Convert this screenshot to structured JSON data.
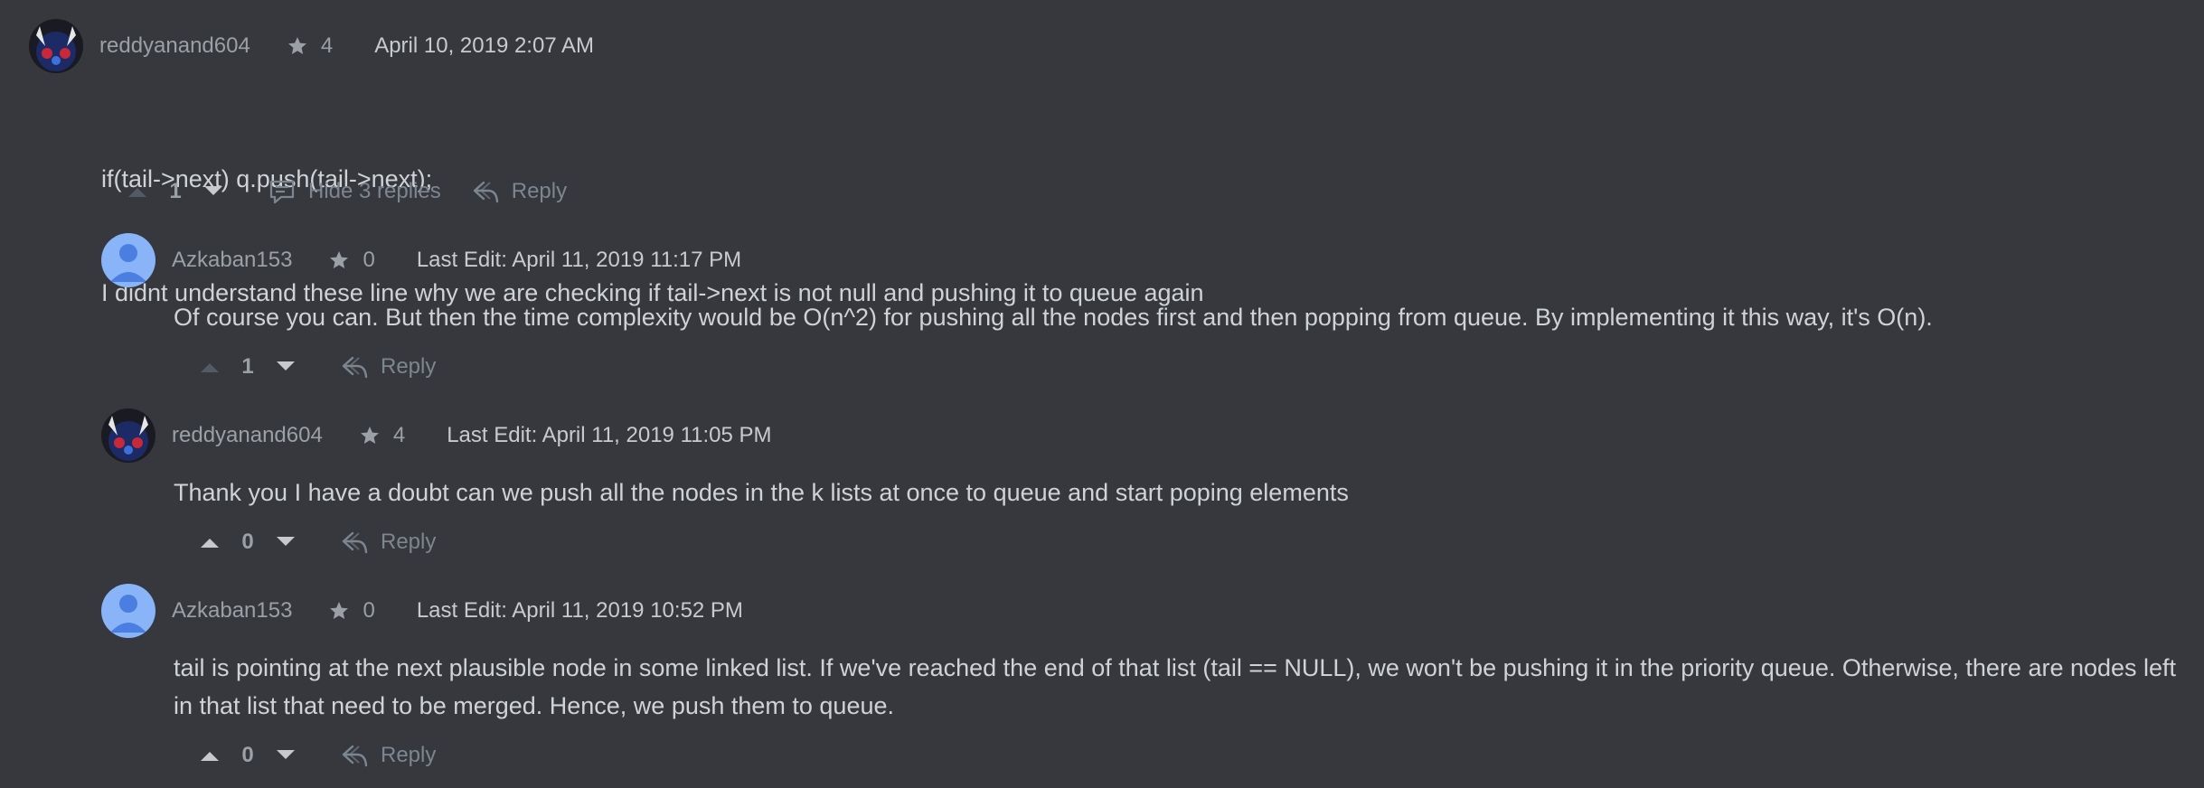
{
  "colors": {
    "background": "#36383d",
    "muted": "#9aa0a6",
    "link": "#7c8691",
    "default_avatar": "#8ab4f8"
  },
  "comments": [
    {
      "username": "reddyanand604",
      "stars": "4",
      "timestamp": "April 10, 2019 2:07 AM",
      "body_lines": [
        "if(tail->next) q.push(tail->next);",
        "I didnt understand these line why we are checking if tail->next is not null and pushing it to queue again"
      ],
      "votes": "1",
      "hide_replies_label": "Hide 3 replies",
      "reply_label": "Reply",
      "avatar": "dark-character-avatar"
    }
  ],
  "replies": [
    {
      "username": "Azkaban153",
      "stars": "0",
      "timestamp": "Last Edit: April 11, 2019 11:17 PM",
      "body": "Of course you can. But then the time complexity would be O(n^2) for pushing all the nodes first and then popping from queue. By implementing it this way, it's O(n).",
      "votes": "1",
      "reply_label": "Reply",
      "avatar": "default-user-avatar"
    },
    {
      "username": "reddyanand604",
      "stars": "4",
      "timestamp": "Last Edit: April 11, 2019 11:05 PM",
      "body": "Thank you I have a doubt can we push all the nodes in the k lists at once to queue and start poping elements",
      "votes": "0",
      "reply_label": "Reply",
      "avatar": "dark-character-avatar"
    },
    {
      "username": "Azkaban153",
      "stars": "0",
      "timestamp": "Last Edit: April 11, 2019 10:52 PM",
      "body": "tail is pointing at the next plausible node in some linked list. If we've reached the end of that list (tail == NULL), we won't be pushing it in the priority queue. Otherwise, there are nodes left in that list that need to be merged. Hence, we push them to queue.",
      "votes": "0",
      "reply_label": "Reply",
      "avatar": "default-user-avatar"
    }
  ]
}
